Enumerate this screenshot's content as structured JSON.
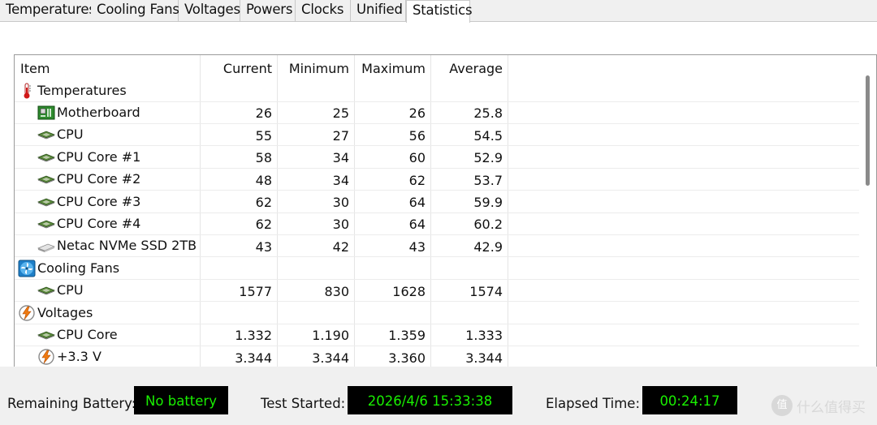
{
  "tabs": [
    "Temperatures",
    "Cooling Fans",
    "Voltages",
    "Powers",
    "Clocks",
    "Unified",
    "Statistics"
  ],
  "active_tab": "Statistics",
  "table": {
    "headers": [
      "Item",
      "Current",
      "Minimum",
      "Maximum",
      "Average"
    ],
    "rows": [
      {
        "kind": "group",
        "icon": "thermometer-icon",
        "label": "Temperatures"
      },
      {
        "kind": "item",
        "icon": "motherboard-icon",
        "label": "Motherboard",
        "current": "26",
        "minimum": "25",
        "maximum": "26",
        "average": "25.8"
      },
      {
        "kind": "item",
        "icon": "chip-icon",
        "label": "CPU",
        "current": "55",
        "minimum": "27",
        "maximum": "56",
        "average": "54.5"
      },
      {
        "kind": "item",
        "icon": "chip-icon",
        "label": "CPU Core #1",
        "current": "58",
        "minimum": "34",
        "maximum": "60",
        "average": "52.9"
      },
      {
        "kind": "item",
        "icon": "chip-icon",
        "label": "CPU Core #2",
        "current": "48",
        "minimum": "34",
        "maximum": "62",
        "average": "53.7"
      },
      {
        "kind": "item",
        "icon": "chip-icon",
        "label": "CPU Core #3",
        "current": "62",
        "minimum": "30",
        "maximum": "64",
        "average": "59.9"
      },
      {
        "kind": "item",
        "icon": "chip-icon",
        "label": "CPU Core #4",
        "current": "62",
        "minimum": "30",
        "maximum": "64",
        "average": "60.2"
      },
      {
        "kind": "item",
        "icon": "ssd-icon",
        "label": "Netac NVMe SSD 2TB",
        "current": "43",
        "minimum": "42",
        "maximum": "43",
        "average": "42.9"
      },
      {
        "kind": "group",
        "icon": "fan-icon",
        "label": "Cooling Fans"
      },
      {
        "kind": "item",
        "icon": "chip-icon",
        "label": "CPU",
        "current": "1577",
        "minimum": "830",
        "maximum": "1628",
        "average": "1574"
      },
      {
        "kind": "group",
        "icon": "voltage-icon",
        "label": "Voltages"
      },
      {
        "kind": "item",
        "icon": "chip-icon",
        "label": "CPU Core",
        "current": "1.332",
        "minimum": "1.190",
        "maximum": "1.359",
        "average": "1.333"
      },
      {
        "kind": "item",
        "icon": "voltage-icon",
        "label": "+3.3 V",
        "current": "3.344",
        "minimum": "3.344",
        "maximum": "3.360",
        "average": "3.344"
      }
    ]
  },
  "footer": {
    "battery_label": "Remaining Battery:",
    "battery_value": "No battery",
    "test_label": "Test Started:",
    "test_value": "2026/4/6 15:33:38",
    "elapsed_label": "Elapsed Time:",
    "elapsed_value": "00:24:17"
  },
  "watermark": {
    "glyph": "值",
    "text": "什么值得买"
  },
  "colors": {
    "display_green": "#19f000",
    "display_bg": "#000000"
  }
}
